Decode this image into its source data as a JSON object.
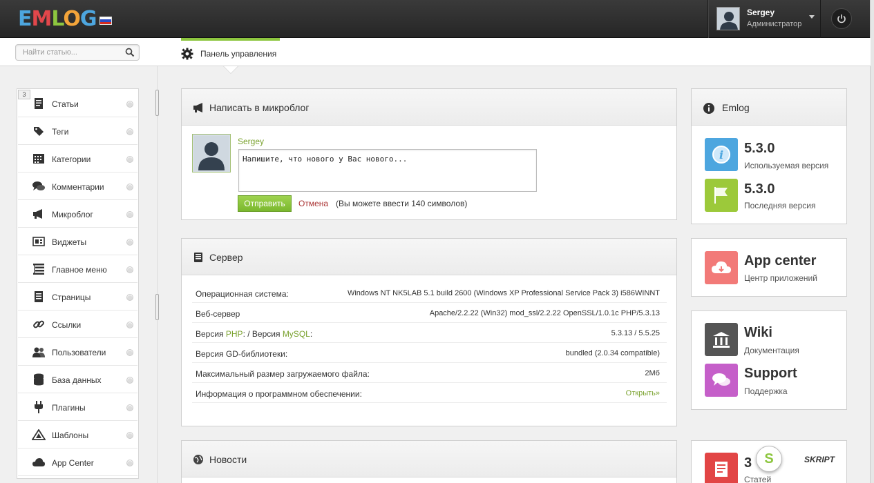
{
  "app": {
    "logo_letters": [
      "E",
      "M",
      "L",
      "O",
      "G"
    ],
    "logo_colors": [
      "#4da6df",
      "#e2474b",
      "#8dc63f",
      "#f3a43a",
      "#4da6df"
    ]
  },
  "user": {
    "name": "Sergey",
    "role": "Администратор"
  },
  "search": {
    "placeholder": "Найти статью..."
  },
  "nav": {
    "dashboard_label": "Панель управления",
    "accent": "#8dc63f"
  },
  "sidebar": {
    "badge": "3",
    "items": [
      {
        "label": "Статьи",
        "icon": "document-icon"
      },
      {
        "label": "Теги",
        "icon": "tag-icon"
      },
      {
        "label": "Категории",
        "icon": "grid-icon"
      },
      {
        "label": "Комментарии",
        "icon": "comments-icon"
      },
      {
        "label": "Микроблог",
        "icon": "megaphone-icon"
      },
      {
        "label": "Виджеты",
        "icon": "widgets-icon"
      },
      {
        "label": "Главное меню",
        "icon": "menu-tree-icon"
      },
      {
        "label": "Страницы",
        "icon": "page-icon"
      },
      {
        "label": "Ссылки",
        "icon": "link-icon"
      },
      {
        "label": "Пользователи",
        "icon": "users-icon"
      },
      {
        "label": "База данных",
        "icon": "database-icon"
      },
      {
        "label": "Плагины",
        "icon": "plug-icon"
      },
      {
        "label": "Шаблоны",
        "icon": "templates-icon"
      },
      {
        "label": "App Center",
        "icon": "cloud-icon"
      }
    ]
  },
  "microblog": {
    "title": "Написать в микроблог",
    "username": "Sergey",
    "textarea_value": "Напишите, что нового у Вас нового...",
    "send_label": "Отправить",
    "cancel_label": "Отмена",
    "hint": "(Вы можете ввести 140 символов)"
  },
  "server": {
    "title": "Сервер",
    "rows": [
      {
        "key": "Операционная система:",
        "value": "Windows NT NK5LAB 5.1 build 2600 (Windows XP Professional Service Pack 3) i586WINNT"
      },
      {
        "key": "Веб-сервер",
        "value": "Apache/2.2.22 (Win32) mod_ssl/2.2.22 OpenSSL/1.0.1c PHP/5.3.13"
      },
      {
        "key_prefix": "Версия ",
        "key_php": "PHP",
        "key_mid": ": / Версия ",
        "key_mysql": "MySQL",
        "key_suffix": ":",
        "value": "5.3.13 / 5.5.25"
      },
      {
        "key": "Версия GD-библиотеки:",
        "value": "bundled (2.0.34 compatible)"
      },
      {
        "key": "Максимальный размер загружаемого файла:",
        "value": "2Мб"
      },
      {
        "key": "Информация о программном обеспечении:",
        "value": "Открыть»"
      }
    ]
  },
  "news": {
    "title": "Новости"
  },
  "emlog_card": {
    "title": "Emlog",
    "current_version": "5.3.0",
    "current_label": "Используемая версия",
    "latest_version": "5.3.0",
    "latest_label": "Последняя версия"
  },
  "app_center": {
    "title": "App center",
    "subtitle": "Центр приложений"
  },
  "wiki": {
    "title": "Wiki",
    "subtitle": "Документация"
  },
  "support": {
    "title": "Support",
    "subtitle": "Поддержка"
  },
  "stats": {
    "count": "3",
    "label": "Статей"
  },
  "watermark": {
    "text": "SKRIPT",
    "letter": "S"
  }
}
